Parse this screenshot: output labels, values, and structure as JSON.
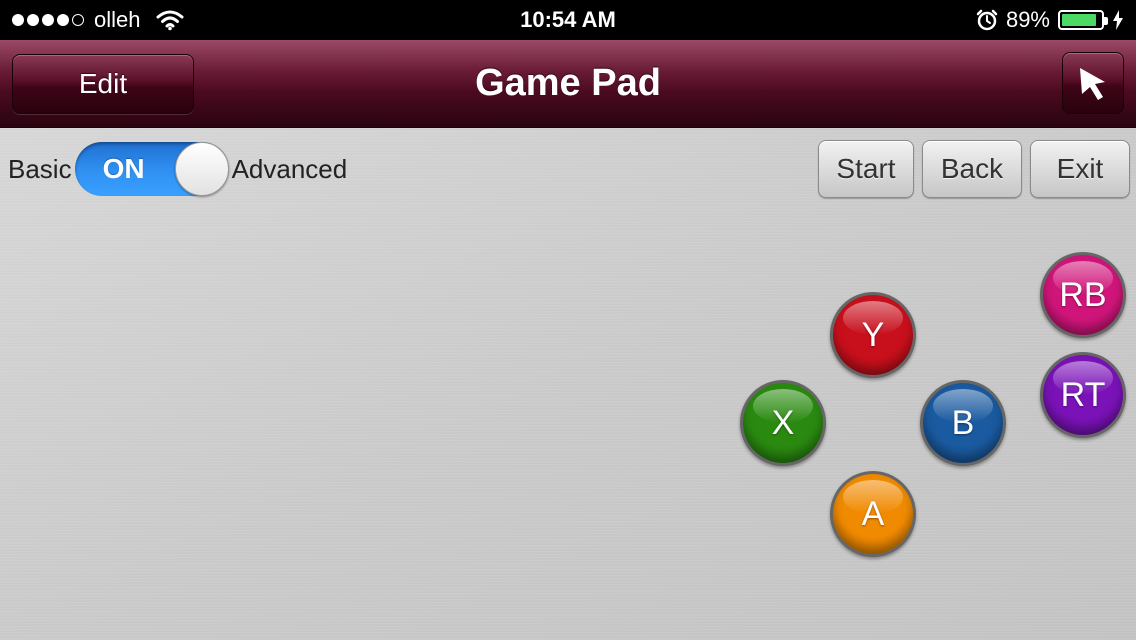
{
  "status_bar": {
    "carrier": "olleh",
    "time": "10:54 AM",
    "battery": "89%",
    "signal_bars_filled": 4,
    "signal_bars_total": 5,
    "battery_level": 0.89,
    "battery_color": "#4cd964"
  },
  "navbar": {
    "title": "Game Pad",
    "edit_label": "Edit",
    "pointer_icon": "cursor-arrow-icon",
    "bar_color": "#4a0a1f"
  },
  "mode": {
    "left_label": "Basic",
    "toggle_text": "ON",
    "right_label": "Advanced",
    "toggle_color": "#2f8ff0"
  },
  "system_buttons": {
    "start": "Start",
    "back": "Back",
    "exit": "Exit"
  },
  "pad_buttons": {
    "y": {
      "label": "Y",
      "color": "#c8101c"
    },
    "x": {
      "label": "X",
      "color": "#2a8a10"
    },
    "b": {
      "label": "B",
      "color": "#1a5aa0"
    },
    "a": {
      "label": "A",
      "color": "#f08a00"
    },
    "rb": {
      "label": "RB",
      "color": "#d0157a"
    },
    "rt": {
      "label": "RT",
      "color": "#7a12b8"
    }
  }
}
